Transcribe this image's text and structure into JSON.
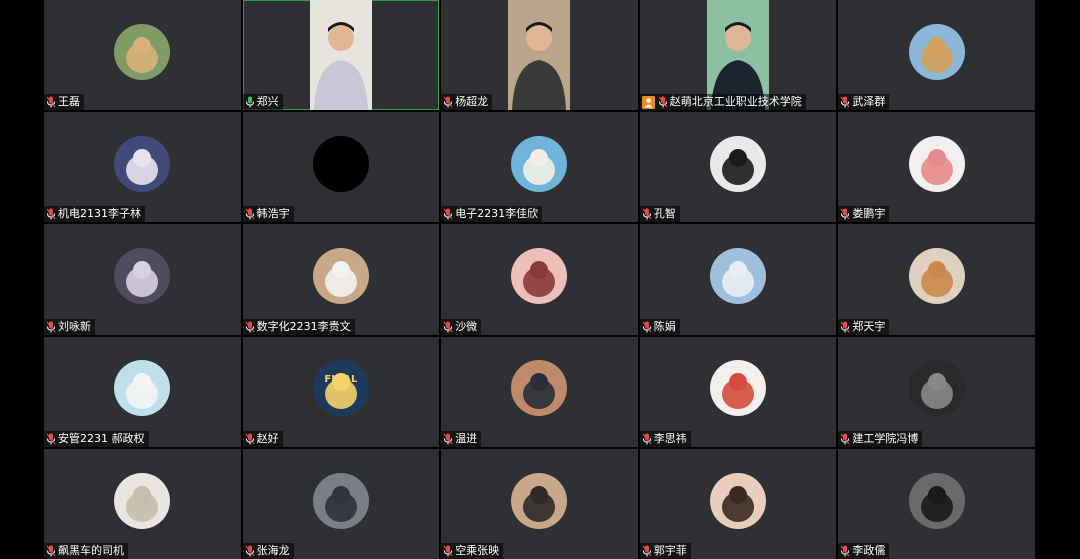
{
  "participants": [
    {
      "name": "王磊",
      "mic": "muted",
      "avatar": {
        "kind": "circle",
        "bg": "#7f9b66",
        "fg": "#d8b07a"
      }
    },
    {
      "name": "郑兴",
      "mic": "speaking",
      "active": true,
      "avatar": {
        "kind": "video",
        "bg": "#e7e4de",
        "fg": "#c8c7d6"
      }
    },
    {
      "name": "杨超龙",
      "mic": "muted",
      "avatar": {
        "kind": "video",
        "bg": "#b9a58c",
        "fg": "#3a3a3a"
      }
    },
    {
      "name": "赵萌北京工业职业技术学院",
      "mic": "muted",
      "host": true,
      "avatar": {
        "kind": "video",
        "bg": "#8cc0a0",
        "fg": "#1c2430"
      }
    },
    {
      "name": "武泽群",
      "mic": "muted",
      "avatar": {
        "kind": "circle",
        "bg": "#8db7d8",
        "fg": "#d4a05c"
      }
    },
    {
      "name": "机电2131李子林",
      "mic": "muted",
      "avatar": {
        "kind": "circle",
        "bg": "#3f4a7a",
        "fg": "#e9e3ee"
      }
    },
    {
      "name": "韩浩宇",
      "mic": "muted",
      "avatar": {
        "kind": "circle",
        "bg": "#000000",
        "fg": "#000000"
      }
    },
    {
      "name": "电子2231李佳欣",
      "mic": "muted",
      "avatar": {
        "kind": "circle",
        "bg": "#6fb4da",
        "fg": "#f3efe6"
      }
    },
    {
      "name": "孔智",
      "mic": "muted",
      "avatar": {
        "kind": "circle",
        "bg": "#e9e9e9",
        "fg": "#1b1b1b"
      }
    },
    {
      "name": "娄鹏宇",
      "mic": "muted",
      "avatar": {
        "kind": "circle",
        "bg": "#f2f0ee",
        "fg": "#e58a8a"
      }
    },
    {
      "name": "刘咏新",
      "mic": "muted",
      "avatar": {
        "kind": "circle",
        "bg": "#4f4c60",
        "fg": "#d9cfe0"
      }
    },
    {
      "name": "数字化2231李贵文",
      "mic": "muted",
      "avatar": {
        "kind": "circle",
        "bg": "#c9a888",
        "fg": "#f2f2f2"
      }
    },
    {
      "name": "沙微",
      "mic": "muted",
      "avatar": {
        "kind": "circle",
        "bg": "#ecc0b6",
        "fg": "#8a3a3a"
      }
    },
    {
      "name": "陈娟",
      "mic": "muted",
      "avatar": {
        "kind": "circle",
        "bg": "#9ec0dc",
        "fg": "#e8eef4"
      }
    },
    {
      "name": "郑天宇",
      "mic": "muted",
      "avatar": {
        "kind": "circle",
        "bg": "#dfd0c0",
        "fg": "#c9894a"
      }
    },
    {
      "name": "安管2231 郝政权",
      "mic": "muted",
      "avatar": {
        "kind": "circle",
        "bg": "#bfe0ea",
        "fg": "#f4f4f4"
      }
    },
    {
      "name": "赵好",
      "mic": "muted",
      "avatar": {
        "kind": "circle",
        "bg": "#1e3a5a",
        "fg": "#f4d36a",
        "text": "FINAL"
      }
    },
    {
      "name": "温进",
      "mic": "muted",
      "avatar": {
        "kind": "circle",
        "bg": "#c08a6a",
        "fg": "#2a2e3a"
      }
    },
    {
      "name": "李思祎",
      "mic": "muted",
      "avatar": {
        "kind": "circle",
        "bg": "#f2efec",
        "fg": "#d64b3e"
      }
    },
    {
      "name": "建工学院冯博",
      "mic": "muted",
      "avatar": {
        "kind": "circle",
        "bg": "#2a2a2a",
        "fg": "#888888"
      }
    },
    {
      "name": "飙黑车的司机",
      "mic": "muted",
      "avatar": {
        "kind": "circle",
        "bg": "#e9e6e2",
        "fg": "#c8bcaa"
      }
    },
    {
      "name": "张海龙",
      "mic": "muted",
      "avatar": {
        "kind": "circle",
        "bg": "#7a7f86",
        "fg": "#30343a"
      }
    },
    {
      "name": "空乘张映",
      "mic": "muted",
      "avatar": {
        "kind": "circle",
        "bg": "#c9a88a",
        "fg": "#2e2a28"
      }
    },
    {
      "name": "郭宇菲",
      "mic": "muted",
      "avatar": {
        "kind": "circle",
        "bg": "#e8cdbb",
        "fg": "#3a2a22"
      }
    },
    {
      "name": "李政儒",
      "mic": "muted",
      "avatar": {
        "kind": "circle",
        "bg": "#6a6a6a",
        "fg": "#1a1a1a"
      }
    }
  ],
  "colors": {
    "tile_bg": "#2e3033",
    "mic_muted": "#e14b4b",
    "mic_speaking": "#3fbf5a",
    "host_badge": "#f08a24",
    "active_border": "#2f9e4a"
  },
  "icons": {
    "mic_muted": "mic-muted-icon",
    "mic_speaking": "mic-speaking-icon",
    "host": "host-icon"
  }
}
